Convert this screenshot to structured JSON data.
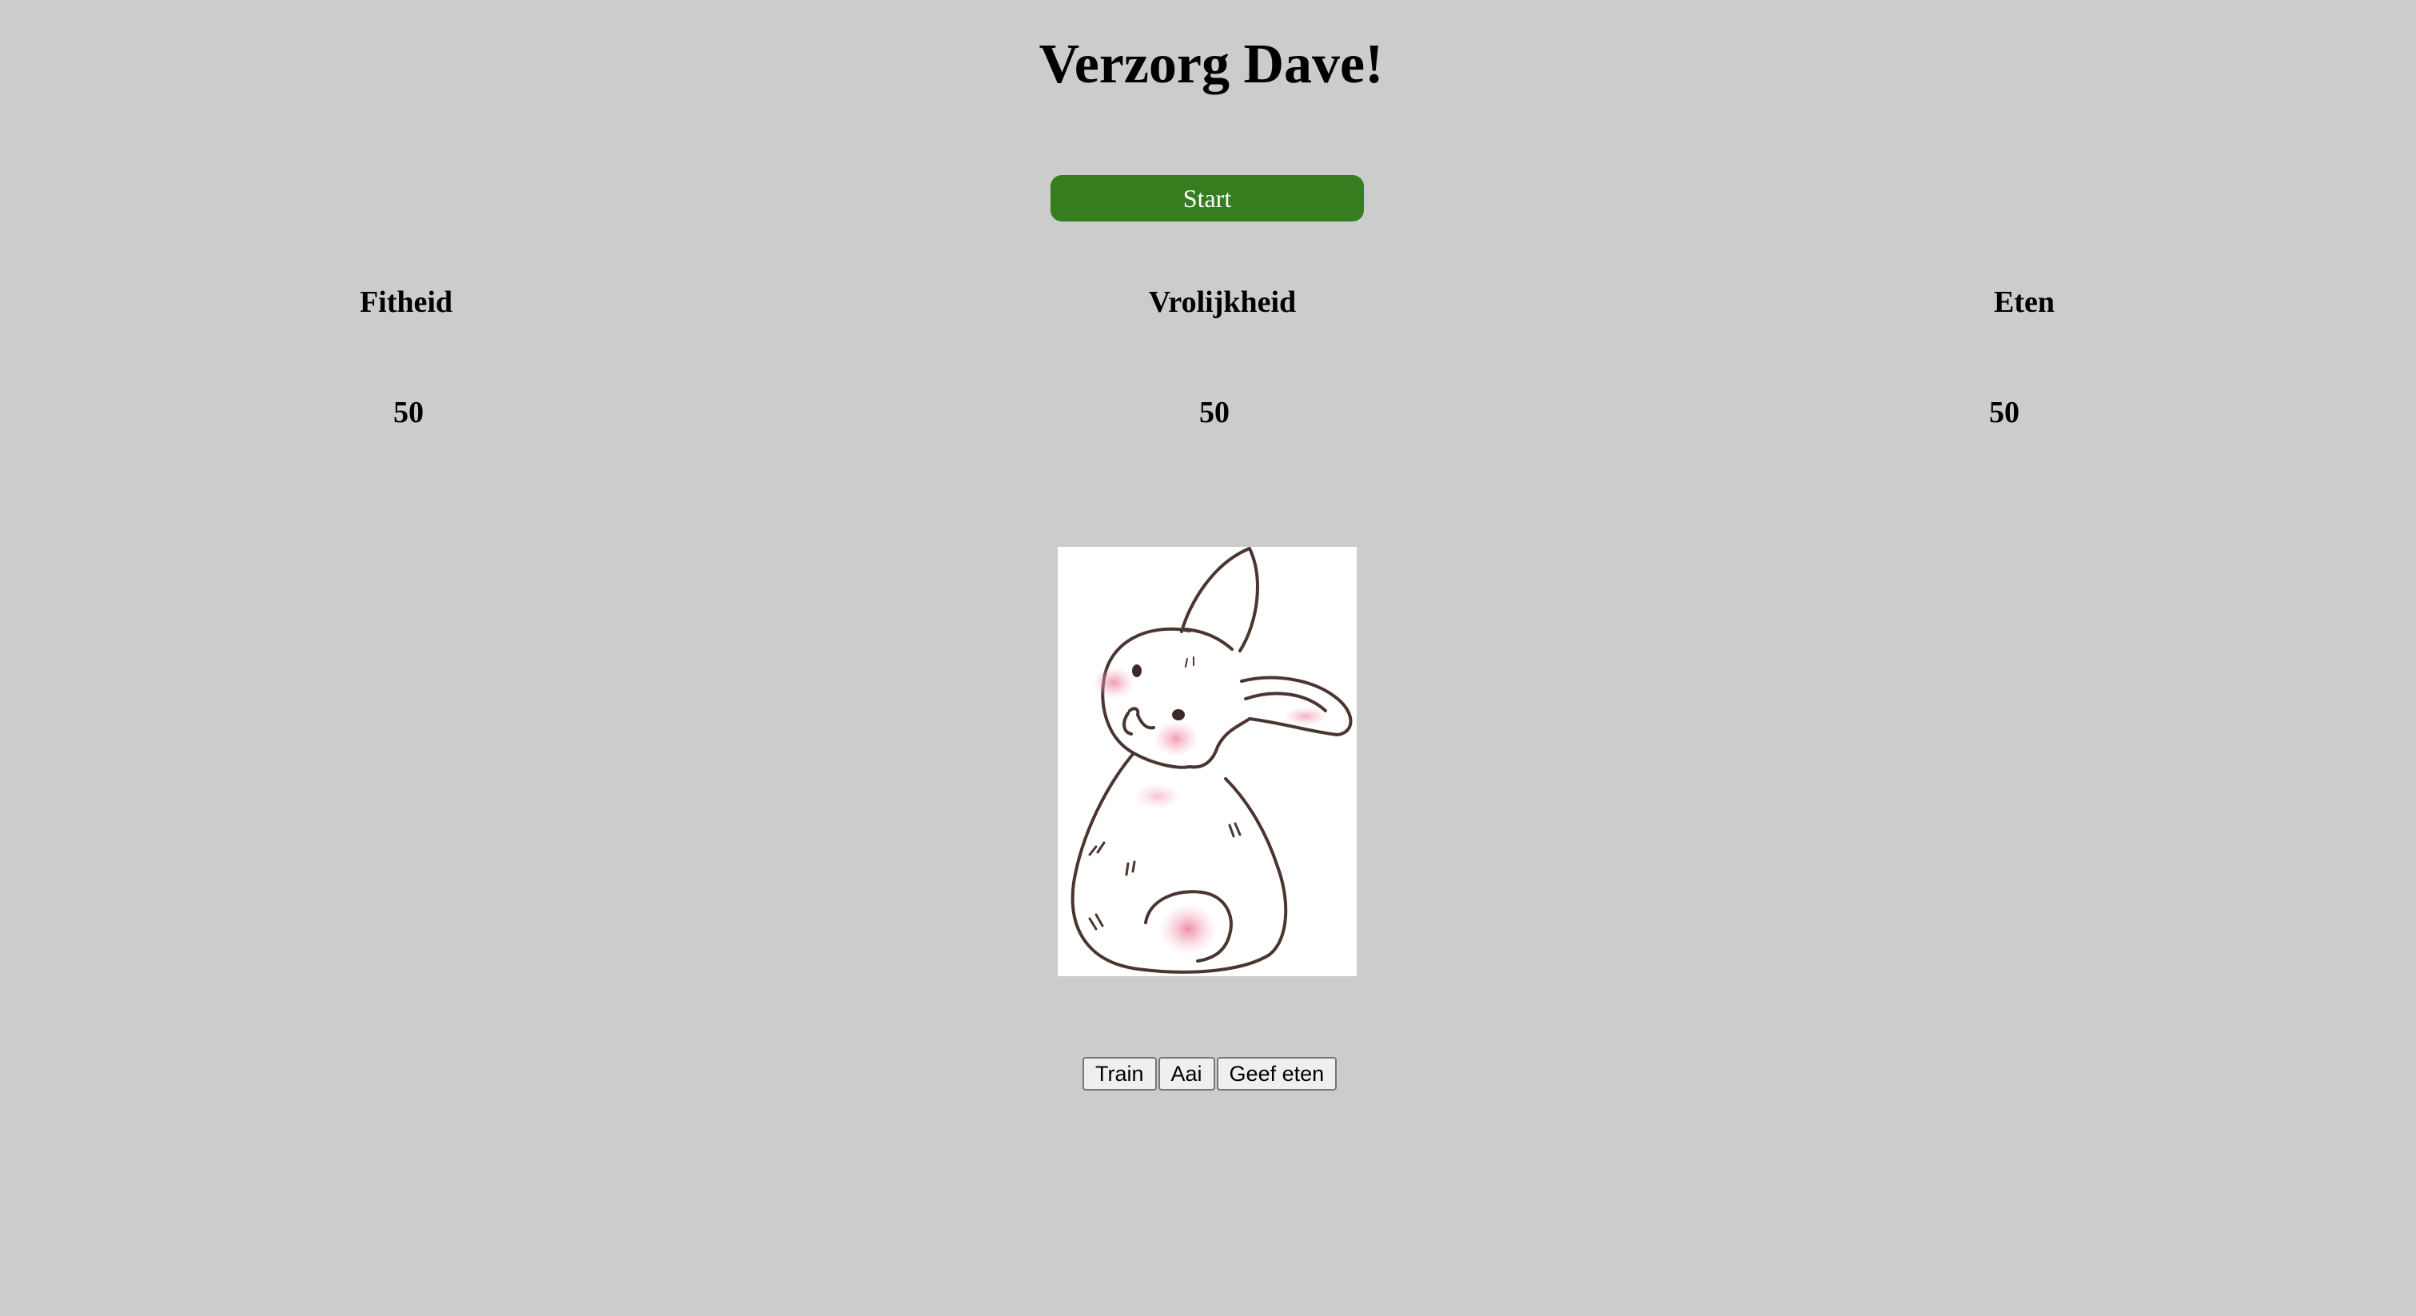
{
  "title": "Verzorg Dave!",
  "start_label": "Start",
  "colors": {
    "background": "#cccccc",
    "start_button": "#367d1f",
    "start_text": "#ffffff"
  },
  "stats": [
    {
      "label": "Fitheid",
      "value": "50"
    },
    {
      "label": "Vrolijkheid",
      "value": "50"
    },
    {
      "label": "Eten",
      "value": "50"
    }
  ],
  "pet": {
    "icon": "bunny-illustration"
  },
  "actions": [
    {
      "label": "Train"
    },
    {
      "label": "Aai"
    },
    {
      "label": "Geef eten"
    }
  ]
}
